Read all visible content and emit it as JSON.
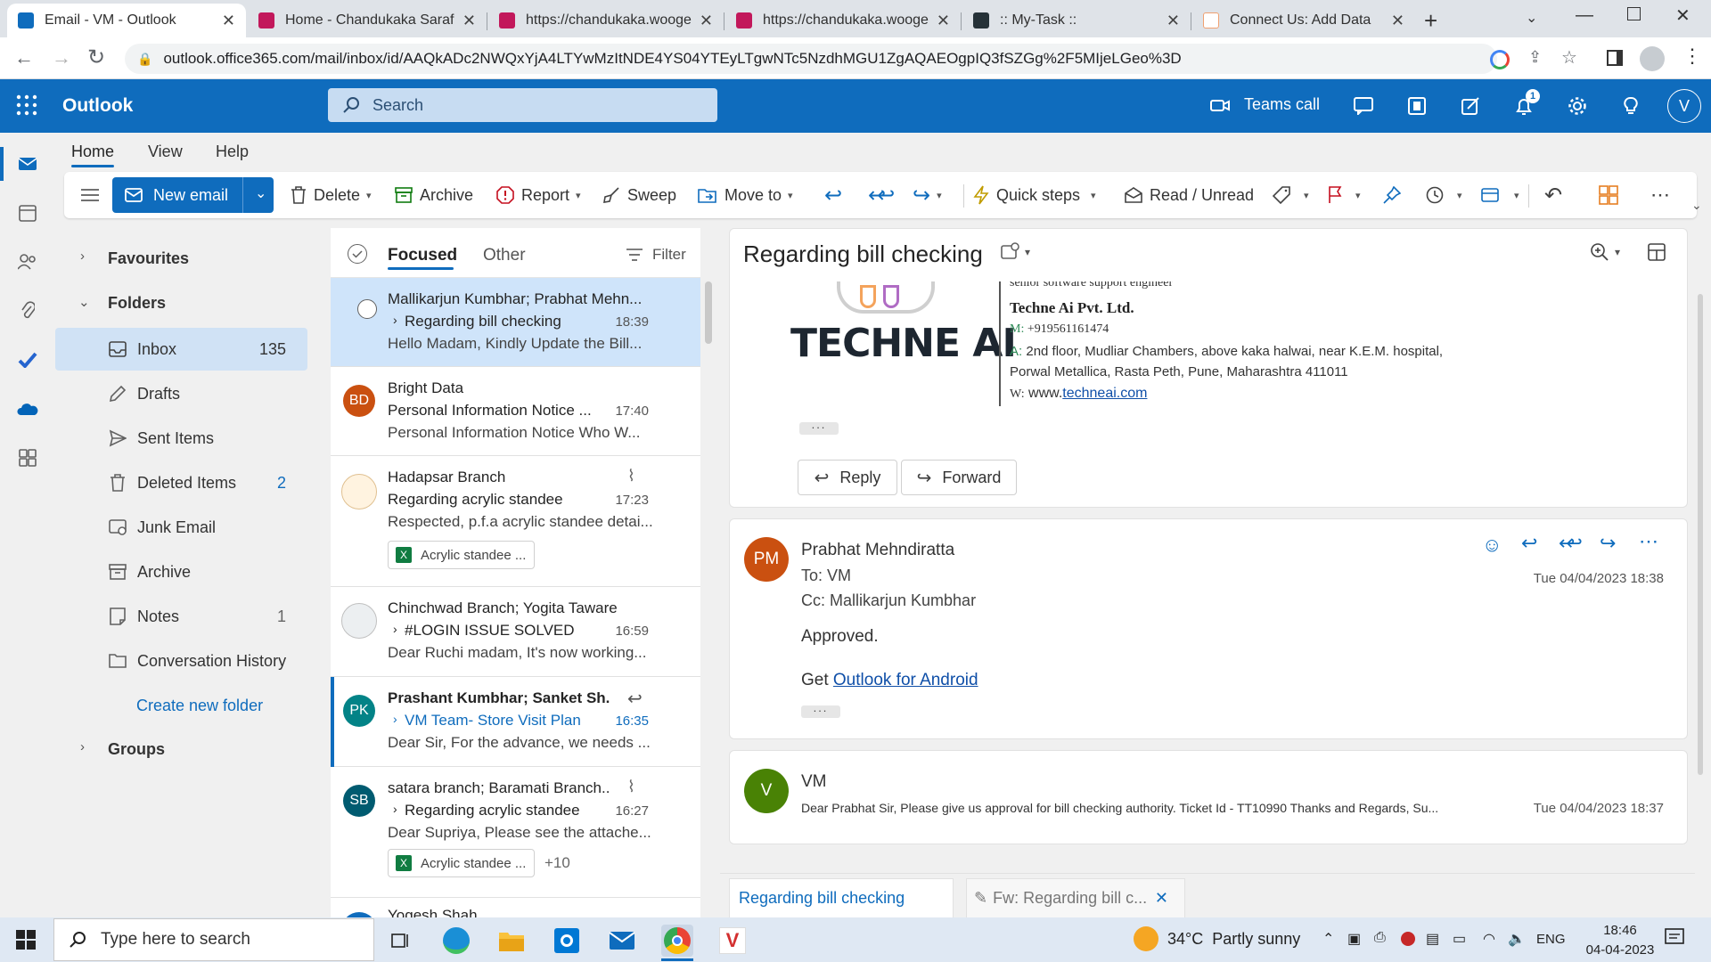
{
  "browser": {
    "tabs": [
      {
        "title": "Email - VM - Outlook",
        "active": true
      },
      {
        "title": "Home - Chandukaka Saraf",
        "active": false
      },
      {
        "title": "https://chandukaka.wooge",
        "active": false
      },
      {
        "title": "https://chandukaka.wooge",
        "active": false
      },
      {
        "title": ":: My-Task ::",
        "active": false
      },
      {
        "title": "Connect Us: Add Data",
        "active": false
      }
    ],
    "url": "outlook.office365.com/mail/inbox/id/AAQkADc2NWQxYjA4LTYwMzItNDE4YS04YTEyLTgwNTc5NzdhMGU1ZgAQAEOgpIQ3fSZGg%2F5MIjeLGeo%3D"
  },
  "header": {
    "app_name": "Outlook",
    "search_placeholder": "Search",
    "teams_call": "Teams call",
    "notification_count": "1",
    "avatar": "V"
  },
  "ribbon": {
    "tabs": [
      "Home",
      "View",
      "Help"
    ],
    "new_email": "New email",
    "delete": "Delete",
    "archive": "Archive",
    "report": "Report",
    "sweep": "Sweep",
    "move_to": "Move to",
    "quick_steps": "Quick steps",
    "read_unread": "Read / Unread"
  },
  "folders": {
    "favourites": "Favourites",
    "folders_label": "Folders",
    "items": [
      {
        "label": "Inbox",
        "count": "135",
        "icon": "inbox-icon"
      },
      {
        "label": "Drafts",
        "count": "",
        "icon": "drafts-icon"
      },
      {
        "label": "Sent Items",
        "count": "",
        "icon": "sent-icon"
      },
      {
        "label": "Deleted Items",
        "count": "2",
        "icon": "trash-icon"
      },
      {
        "label": "Junk Email",
        "count": "",
        "icon": "junk-icon"
      },
      {
        "label": "Archive",
        "count": "",
        "icon": "archive-icon"
      },
      {
        "label": "Notes",
        "count": "1",
        "icon": "notes-icon"
      },
      {
        "label": "Conversation History",
        "count": "",
        "icon": "folder-icon"
      }
    ],
    "create_new": "Create new folder",
    "groups": "Groups"
  },
  "message_list": {
    "focused": "Focused",
    "other": "Other",
    "filter": "Filter",
    "messages": [
      {
        "sender": "Mallikarjun Kumbhar; Prabhat Mehn...",
        "subject": "Regarding bill checking",
        "time": "18:39",
        "preview": "Hello Madam, Kindly Update the Bill...",
        "initials": "",
        "color": ""
      },
      {
        "sender": "Bright Data",
        "subject": "Personal Information Notice ...",
        "time": "17:40",
        "preview": "Personal Information Notice Who W...",
        "initials": "BD",
        "color": "#ca5010"
      },
      {
        "sender": "Hadapsar Branch",
        "subject": "Regarding acrylic standee",
        "time": "17:23",
        "preview": "Respected, p.f.a acrylic standee detai...",
        "initials": "",
        "color": "",
        "attachment": "Acrylic standee ..."
      },
      {
        "sender": "Chinchwad Branch; Yogita Taware",
        "subject": "#LOGIN ISSUE SOLVED",
        "time": "16:59",
        "preview": "Dear Ruchi madam, It's now working...",
        "initials": "",
        "color": ""
      },
      {
        "sender": "Prashant Kumbhar; Sanket Sh...",
        "subject": "VM Team- Store Visit Plan",
        "time": "16:35",
        "preview": "Dear Sir, For the advance, we needs ...",
        "initials": "PK",
        "color": "#038387"
      },
      {
        "sender": "satara branch; Baramati Branch...",
        "subject": "Regarding acrylic standee",
        "time": "16:27",
        "preview": "Dear Supriya, Please see the attache...",
        "initials": "SB",
        "color": "#005b70",
        "attachment": "Acrylic standee ...",
        "more": "+10"
      },
      {
        "sender": "Yogesh Shah",
        "subject": "",
        "time": "",
        "preview": "",
        "initials": "",
        "color": ""
      }
    ]
  },
  "reading": {
    "subject": "Regarding bill checking",
    "signature": {
      "role": "senior software support engineer",
      "company": "Techne Ai Pvt. Ltd.",
      "m_label": "M:",
      "mobile": "+919561161474",
      "a_label": "A:",
      "address1": "2nd floor, Mudliar Chambers, above kaka halwai, near K.E.M. hospital,",
      "address2": "Porwal Metallica, Rasta Peth, Pune, Maharashtra 411011",
      "w_label": "W:",
      "web_prefix": "www.",
      "web_link": "techneai.com",
      "logo_text": "TECHNE AI"
    },
    "reply": "Reply",
    "forward": "Forward",
    "message2": {
      "initials": "PM",
      "sender": "Prabhat Mehndiratta",
      "to": "To:  VM",
      "cc": "Cc:  Mallikarjun Kumbhar",
      "date": "Tue 04/04/2023 18:38",
      "body": "Approved.",
      "get": "Get",
      "link": "Outlook for Android"
    },
    "message3": {
      "initials": "V",
      "sender": "VM",
      "preview": "Dear Prabhat Sir, Please give us approval for bill checking authority. Ticket Id - TT10990 Thanks and Regards, Su...",
      "date": "Tue 04/04/2023 18:37"
    }
  },
  "bottom_tabs": [
    "Regarding bill checking",
    "Fw: Regarding bill c..."
  ],
  "taskbar": {
    "search_placeholder": "Type here to search",
    "weather": "34°C  Partly sunny",
    "lang": "ENG",
    "time": "18:46",
    "date": "04-04-2023"
  }
}
